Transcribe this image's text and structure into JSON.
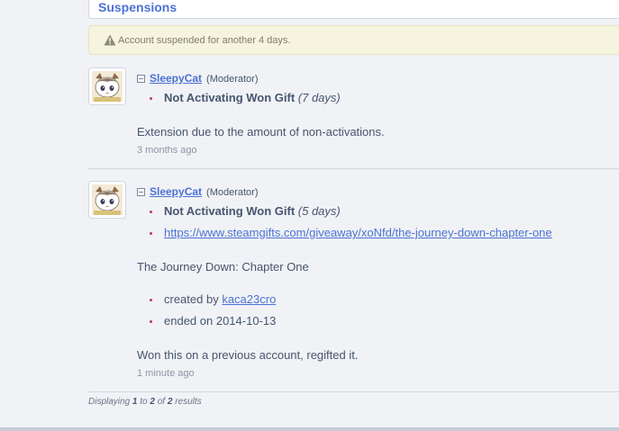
{
  "section": {
    "title": "Suspensions"
  },
  "notice": {
    "text": "Account suspended for another 4 days.",
    "icon": "warning-icon"
  },
  "entries": [
    {
      "username": "SleepyCat",
      "role": "(Moderator)",
      "reason": "Not Activating Won Gift",
      "duration": "(7 days)",
      "comment": "Extension due to the amount of non-activations.",
      "time": "3 months ago"
    },
    {
      "username": "SleepyCat",
      "role": "(Moderator)",
      "reason": "Not Activating Won Gift",
      "duration": "(5 days)",
      "link": "https://www.steamgifts.com/giveaway/xoNfd/the-journey-down-chapter-one",
      "game_title": "The Journey Down: Chapter One",
      "created_by_label": "created by",
      "created_by_user": "kaca23cro",
      "ended_label": "ended on 2014-10-13",
      "comment": "Won this on a previous account, regifted it.",
      "time": "1 minute ago"
    }
  ],
  "footer": {
    "prefix": "Displaying",
    "from": "1",
    "to_label": "to",
    "to": "2",
    "of_label": "of",
    "total": "2",
    "suffix": "results"
  }
}
